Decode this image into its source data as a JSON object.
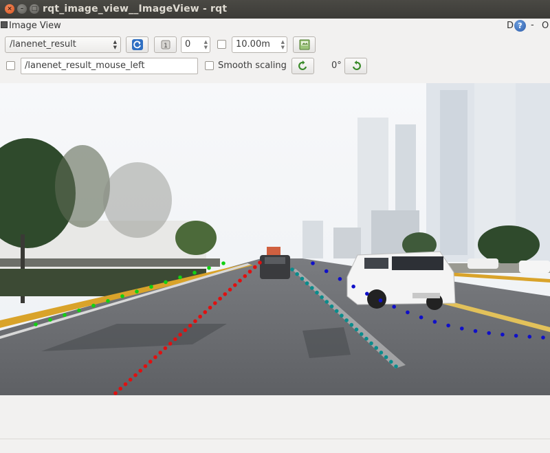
{
  "window": {
    "title": "rqt_image_view__ImageView - rqt",
    "close_glyph": "×",
    "minimize_glyph": "–",
    "maximize_glyph": "□"
  },
  "dock": {
    "title": "Image View",
    "d_label": "D",
    "help_glyph": "?",
    "dash_label": "-",
    "o_label": "O"
  },
  "toolbar": {
    "topic_selected": "/lanenet_result",
    "spin_value": "0",
    "duration_value": "10.00m",
    "refresh_icon": "refresh-icon",
    "save_icon": "save-image-icon"
  },
  "row2": {
    "mouse_topic": "/lanenet_result_mouse_left",
    "smooth_label": "Smooth scaling",
    "rotation": "0°"
  },
  "colors": {
    "lane_left": "#12d012",
    "lane_ego_left": "#e01010",
    "lane_ego_right": "#0a8c8c",
    "lane_right": "#1010c8"
  }
}
